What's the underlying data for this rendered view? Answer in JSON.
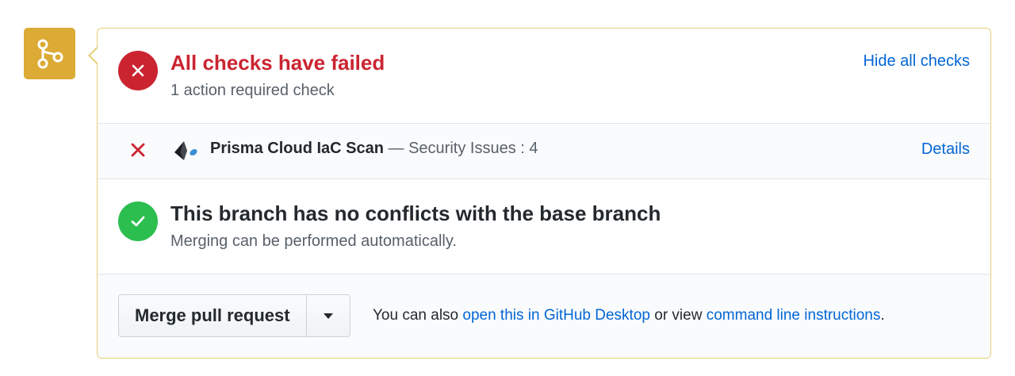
{
  "checks_summary": {
    "title": "All checks have failed",
    "subtitle": "1 action required check",
    "hide_link": "Hide all checks"
  },
  "check_item": {
    "name": "Prisma Cloud IaC Scan",
    "separator": " — ",
    "description": "Security Issues : 4",
    "details_link": "Details"
  },
  "branch_status": {
    "title": "This branch has no conflicts with the base branch",
    "subtitle": "Merging can be performed automatically."
  },
  "merge": {
    "button_label": "Merge pull request",
    "note_prefix": "You can also ",
    "desktop_link": "open this in GitHub Desktop",
    "note_middle": " or view ",
    "cli_link": "command line instructions",
    "note_suffix": "."
  },
  "icons": {
    "merge_badge": "git-merge-icon",
    "fail_status": "x-circle-icon",
    "ok_status": "check-circle-icon",
    "check_fail": "x-icon",
    "provider_logo": "prisma-cloud-logo",
    "dropdown": "caret-down-icon"
  },
  "colors": {
    "merge_badge": "#dbab35",
    "fail": "#cb2431",
    "success": "#2cbe4e",
    "link": "#0366d6",
    "panel_border": "#e6d07a"
  }
}
